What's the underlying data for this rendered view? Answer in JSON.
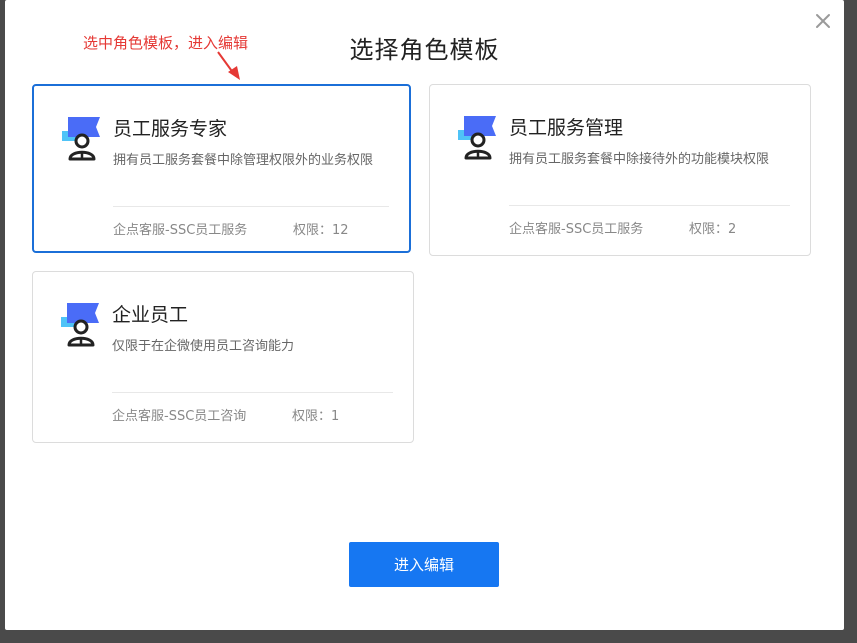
{
  "modal": {
    "title": "选择角色模板",
    "annotation": "选中角色模板，进入编辑",
    "close_icon": "close-icon",
    "submit_label": "进入编辑"
  },
  "cards": [
    {
      "name": "员工服务专家",
      "desc": "拥有员工服务套餐中除管理权限外的业务权限",
      "meta": "企点客服-SSC员工服务",
      "perm": "权限：12",
      "selected": true
    },
    {
      "name": "员工服务管理",
      "desc": "拥有员工服务套餐中除接待外的功能模块权限",
      "meta": "企点客服-SSC员工服务",
      "perm": "权限：2",
      "selected": false
    },
    {
      "name": "企业员工",
      "desc": "仅限于在企微使用员工咨询能力",
      "meta": "企点客服-SSC员工咨询",
      "perm": "权限：1",
      "selected": false
    }
  ],
  "colors": {
    "accent": "#1677f2",
    "selected_border": "#1b6fd8",
    "annotation": "#e53935",
    "icon_blue": "#4a6cf7",
    "icon_light": "#4fc3f7"
  }
}
